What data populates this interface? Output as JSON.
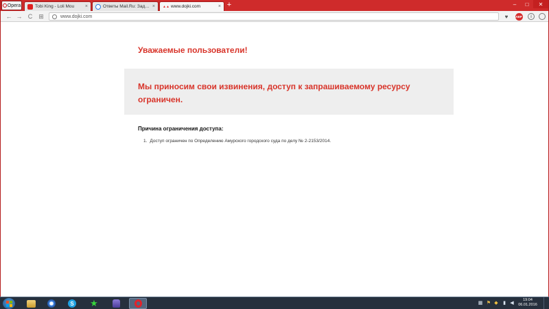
{
  "browser": {
    "menu_label": "Opera",
    "tabs": [
      {
        "label": "Tobi King - Loli Mou",
        "favicon": "youtube-icon",
        "active": false
      },
      {
        "label": "Ответы Mail.Ru: Задать",
        "favicon": "mail-ru-answers-icon",
        "active": false
      },
      {
        "label": "www.dojki.com",
        "favicon": "dojki-icon",
        "active": true
      }
    ],
    "new_tab": "+",
    "close": "×",
    "window_controls": {
      "minimize": "–",
      "maximize": "□",
      "close": "✕"
    },
    "address": "www.dojki.com",
    "abp_label": "ABP",
    "nav": {
      "back": "←",
      "forward": "→",
      "reload": "C",
      "speed_dial": "⊞"
    },
    "icons": {
      "bookmark": "♥",
      "adblock": "abp-icon",
      "download": "⇩",
      "account": "◯"
    }
  },
  "page": {
    "greeting": "Уважаемые пользователи!",
    "apology": "Мы приносим свои извинения, доступ к запрашиваемому ресурсу ограничен.",
    "reason_title": "Причина ограничения доступа:",
    "reasons": [
      {
        "num": "1.",
        "text": "Доступ ограничен по Определению Амурского городского суда по делу № 2-2153/2014."
      }
    ],
    "colors": {
      "accent": "#d8342a",
      "panel": "#eeeeee"
    }
  },
  "taskbar": {
    "items": [
      "explorer-icon",
      "chrome-icon",
      "skype-icon",
      "star-icon",
      "game-icon",
      "opera-icon"
    ],
    "tray": [
      "network-icon",
      "flag-icon",
      "security-icon",
      "signal-icon",
      "volume-icon"
    ],
    "time": "19:04",
    "date": "06.01.2016"
  }
}
